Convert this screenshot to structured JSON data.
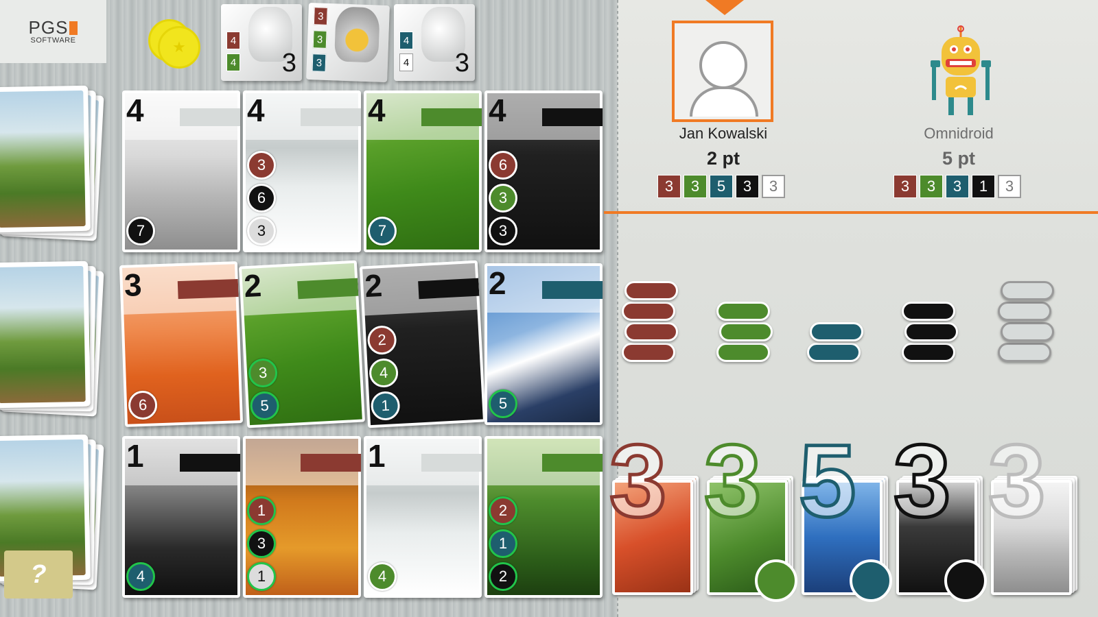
{
  "logo": {
    "brand": "PGS",
    "sub": "SOFTWARE"
  },
  "colors": {
    "red": "#8b3a31",
    "green": "#4d8b2c",
    "teal": "#1e5e6e",
    "black": "#111111",
    "white": "#d7dbda",
    "accent": "#f07a24",
    "yellow": "#f1e51d"
  },
  "coin_icon": "star-coin-icon",
  "statues": [
    {
      "boxes": [
        {
          "v": "4",
          "c": "red"
        },
        {
          "v": "4",
          "c": "green"
        }
      ],
      "count": "3",
      "robot": false
    },
    {
      "boxes": [
        {
          "v": "3",
          "c": "red"
        },
        {
          "v": "3",
          "c": "green"
        },
        {
          "v": "3",
          "c": "teal"
        }
      ],
      "count": "",
      "robot": true
    },
    {
      "boxes": [
        {
          "v": "4",
          "c": "teal"
        },
        {
          "v": "4",
          "c": "white"
        }
      ],
      "count": "3",
      "robot": false
    }
  ],
  "grid": [
    [
      {
        "value": "4",
        "bar": "white",
        "scene": "clouds",
        "tokens": [
          {
            "v": "7",
            "c": "black",
            "hl": false
          }
        ]
      },
      {
        "value": "4",
        "bar": "white",
        "scene": "snow",
        "tokens": [
          {
            "v": "3",
            "c": "red",
            "hl": false
          },
          {
            "v": "6",
            "c": "black",
            "hl": false
          },
          {
            "v": "3",
            "c": "white",
            "hl": false
          }
        ]
      },
      {
        "value": "4",
        "bar": "green",
        "scene": "field",
        "tokens": [
          {
            "v": "7",
            "c": "teal",
            "hl": false
          }
        ]
      },
      {
        "value": "4",
        "bar": "black",
        "scene": "diver",
        "tokens": [
          {
            "v": "6",
            "c": "red",
            "hl": false
          },
          {
            "v": "3",
            "c": "green",
            "hl": false
          },
          {
            "v": "3",
            "c": "black",
            "hl": false
          }
        ]
      }
    ],
    [
      {
        "value": "3",
        "bar": "red",
        "scene": "desert",
        "tokens": [
          {
            "v": "6",
            "c": "red",
            "hl": false
          }
        ]
      },
      {
        "value": "2",
        "bar": "green",
        "scene": "field",
        "tokens": [
          {
            "v": "3",
            "c": "green",
            "hl": true
          },
          {
            "v": "5",
            "c": "teal",
            "hl": true
          }
        ]
      },
      {
        "value": "2",
        "bar": "black",
        "scene": "diver",
        "tokens": [
          {
            "v": "2",
            "c": "red",
            "hl": false
          },
          {
            "v": "4",
            "c": "green",
            "hl": false
          },
          {
            "v": "1",
            "c": "teal",
            "hl": false
          }
        ]
      },
      {
        "value": "2",
        "bar": "teal",
        "scene": "mountain",
        "tokens": [
          {
            "v": "5",
            "c": "teal",
            "hl": true
          }
        ]
      }
    ],
    [
      {
        "value": "1",
        "bar": "black",
        "scene": "dark",
        "tokens": [
          {
            "v": "4",
            "c": "teal",
            "hl": true
          }
        ]
      },
      {
        "value": "",
        "bar": "red",
        "scene": "autumn",
        "tokens": [
          {
            "v": "1",
            "c": "red",
            "hl": true
          },
          {
            "v": "3",
            "c": "black",
            "hl": true
          },
          {
            "v": "1",
            "c": "white",
            "hl": true
          }
        ]
      },
      {
        "value": "1",
        "bar": "white",
        "scene": "snow",
        "tokens": [
          {
            "v": "4",
            "c": "green",
            "hl": false
          }
        ]
      },
      {
        "value": "",
        "bar": "green",
        "scene": "forest",
        "tokens": [
          {
            "v": "2",
            "c": "red",
            "hl": true
          },
          {
            "v": "1",
            "c": "teal",
            "hl": true
          },
          {
            "v": "2",
            "c": "black",
            "hl": true
          }
        ]
      }
    ]
  ],
  "help_label": "?",
  "players": [
    {
      "name": "Jan Kowalski",
      "points": "2 pt",
      "scores": [
        "3",
        "3",
        "5",
        "3",
        "3"
      ],
      "active": true
    },
    {
      "name": "Omnidroid",
      "points": "5 pt",
      "scores": [
        "3",
        "3",
        "3",
        "1",
        "3"
      ],
      "active": false
    }
  ],
  "stacks": [
    {
      "color": "red",
      "count": 4
    },
    {
      "color": "green",
      "count": 3
    },
    {
      "color": "teal",
      "count": 2
    },
    {
      "color": "black",
      "count": 3
    },
    {
      "color": "white",
      "count": 4
    }
  ],
  "collected": [
    {
      "value": "3",
      "color": "red",
      "scene": "bridge",
      "dot": false
    },
    {
      "value": "3",
      "color": "green",
      "scene": "leaf",
      "dot": true
    },
    {
      "value": "5",
      "color": "teal",
      "scene": "lake",
      "dot": true
    },
    {
      "value": "3",
      "color": "black",
      "scene": "trees",
      "dot": true
    },
    {
      "value": "3",
      "color": "white",
      "scene": "clouds",
      "dot": false
    }
  ]
}
